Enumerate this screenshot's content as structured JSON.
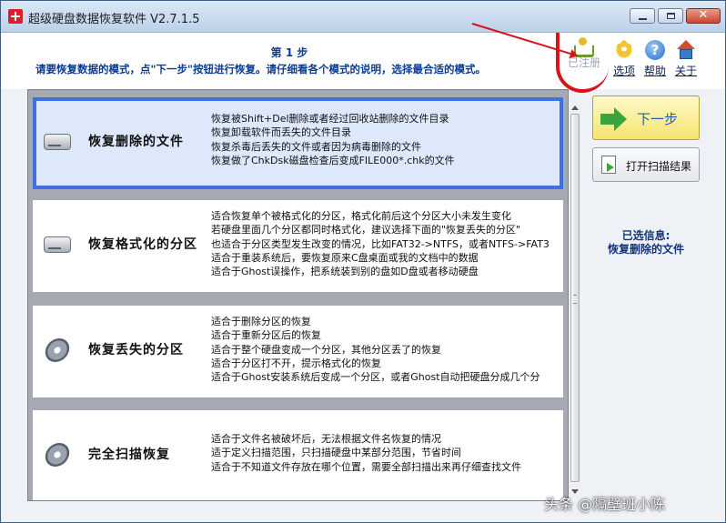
{
  "window": {
    "title": "超级硬盘数据恢复软件 V2.7.1.5",
    "close_glyph": "✕"
  },
  "header": {
    "step": "第 1 步",
    "instruction": "请要恢复数据的模式，点\"下一步\"按钮进行恢复。请仔细看各个模式的说明，选择最合适的模式。"
  },
  "toolbar": [
    {
      "label": "已注册",
      "icon": "cart-icon",
      "enabled": false
    },
    {
      "label": "选项",
      "icon": "gear-icon"
    },
    {
      "label": "帮助",
      "icon": "help-icon",
      "glyph": "?"
    },
    {
      "label": "关于",
      "icon": "home-icon"
    }
  ],
  "modes": [
    {
      "title": "恢复删除的文件",
      "icon": "drive-icon",
      "selected": true,
      "lines": [
        "恢复被Shift+Del删除或者经过回收站删除的文件目录",
        "恢复卸载软件而丢失的文件目录",
        "恢复杀毒后丢失的文件或者因为病毒删除的文件",
        "恢复做了ChkDsk磁盘检查后变成FILE000*.chk的文件"
      ]
    },
    {
      "title": "恢复格式化的分区",
      "icon": "drive-icon",
      "selected": false,
      "lines": [
        "适合恢复单个被格式化的分区，格式化前后这个分区大小未发生变化",
        "若硬盘里面几个分区都同时格式化，建议选择下面的\"恢复丢失的分区\"",
        "也适合于分区类型发生改变的情况，比如FAT32->NTFS，或者NTFS->FAT3",
        "适合于重装系统后，要恢复原来C盘桌面或我的文档中的数据",
        "适合于Ghost误操作，把系统装到别的盘如D盘或者移动硬盘"
      ]
    },
    {
      "title": "恢复丢失的分区",
      "icon": "hard-disk-icon",
      "selected": false,
      "lines": [
        "适合于删除分区的恢复",
        "适合于重新分区后的恢复",
        "适合于整个硬盘变成一个分区，其他分区丢了的恢复",
        "适合于分区打不开，提示格式化的恢复",
        "适合于Ghost安装系统后变成一个分区，或者Ghost自动把硬盘分成几个分"
      ]
    },
    {
      "title": "完全扫描恢复",
      "icon": "hard-disk-icon",
      "selected": false,
      "lines": [
        "适合于文件名被破坏后，无法根据文件名恢复的情况",
        "适于定义扫描范围，只扫描硬盘中某部分范围，节省时间",
        "适合于不知道文件存放在哪个位置，需要全部扫描出来再仔细查找文件"
      ]
    }
  ],
  "actions": {
    "next_label": "下一步",
    "open_scan_label": "打开扫描结果"
  },
  "selected_info": {
    "label": "已选信息:",
    "value": "恢复删除的文件"
  },
  "watermark": "头条 @隔壁班小陈",
  "colors": {
    "annotation": "#d8141a",
    "selection_border": "#3f6fe0",
    "header_text": "#0b3d91"
  }
}
